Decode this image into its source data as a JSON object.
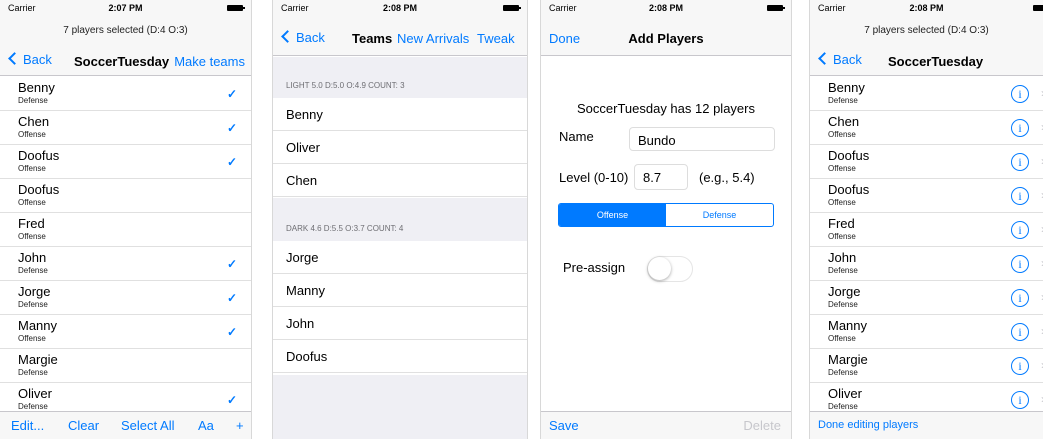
{
  "colors": {
    "accent": "#007aff",
    "check": "#007aff",
    "section_bg": "#efeff4",
    "disabled": "#c7c7cc"
  },
  "status_bar": [
    {
      "carrier": "Carrier",
      "time": "2:07 PM"
    },
    {
      "carrier": "Carrier",
      "time": "2:08 PM"
    },
    {
      "carrier": "Carrier",
      "time": "2:08 PM"
    },
    {
      "carrier": "Carrier",
      "time": "2:08 PM"
    }
  ],
  "screen1": {
    "prompt": "7 players selected (D:4 O:3)",
    "back_label": "Back",
    "title": "SoccerTuesday",
    "right_action": "Make teams",
    "players": [
      {
        "name": "Benny",
        "position": "Defense",
        "checked": true
      },
      {
        "name": "Chen",
        "position": "Offense",
        "checked": true
      },
      {
        "name": "Doofus",
        "position": "Offense",
        "checked": true
      },
      {
        "name": "Doofus",
        "position": "Offense",
        "checked": false
      },
      {
        "name": "Fred",
        "position": "Offense",
        "checked": false
      },
      {
        "name": "John",
        "position": "Defense",
        "checked": true
      },
      {
        "name": "Jorge",
        "position": "Defense",
        "checked": true
      },
      {
        "name": "Manny",
        "position": "Offense",
        "checked": true
      },
      {
        "name": "Margie",
        "position": "Defense",
        "checked": false
      },
      {
        "name": "Oliver",
        "position": "Defense",
        "checked": true
      }
    ],
    "toolbar": {
      "edit": "Edit...",
      "clear": "Clear",
      "select_all": "Select All",
      "font": "Aa",
      "add": "+"
    }
  },
  "screen2": {
    "back_label": "Back",
    "title": "Teams",
    "action1": "New Arrivals",
    "action2": "Tweak",
    "teams": [
      {
        "header": "LIGHT 5.0 D:5.0 O:4.9 COUNT: 3",
        "players": [
          "Benny",
          "Oliver",
          "Chen"
        ]
      },
      {
        "header": "DARK 4.6 D:5.5 O:3.7 COUNT: 4",
        "players": [
          "Jorge",
          "Manny",
          "John",
          "Doofus"
        ]
      }
    ]
  },
  "screen3": {
    "done_label": "Done",
    "title": "Add Players",
    "summary": "SoccerTuesday has 12 players",
    "name_label": "Name",
    "name_value": "Bundo",
    "level_label": "Level (0-10)",
    "level_value": "8.7",
    "level_hint": "(e.g., 5.4)",
    "segments": [
      "Offense",
      "Defense"
    ],
    "selected_segment": "Offense",
    "preassign_label": "Pre-assign",
    "preassign_on": false,
    "save_label": "Save",
    "delete_label": "Delete"
  },
  "screen4": {
    "prompt": "7 players selected (D:4 O:3)",
    "back_label": "Back",
    "title": "SoccerTuesday",
    "players": [
      {
        "name": "Benny",
        "position": "Defense"
      },
      {
        "name": "Chen",
        "position": "Offense"
      },
      {
        "name": "Doofus",
        "position": "Offense"
      },
      {
        "name": "Doofus",
        "position": "Offense"
      },
      {
        "name": "Fred",
        "position": "Offense"
      },
      {
        "name": "John",
        "position": "Defense"
      },
      {
        "name": "Jorge",
        "position": "Defense"
      },
      {
        "name": "Manny",
        "position": "Offense"
      },
      {
        "name": "Margie",
        "position": "Defense"
      },
      {
        "name": "Oliver",
        "position": "Defense"
      }
    ],
    "info_glyph": "i",
    "disclosure_glyph": "›",
    "footer": "Done editing players"
  }
}
